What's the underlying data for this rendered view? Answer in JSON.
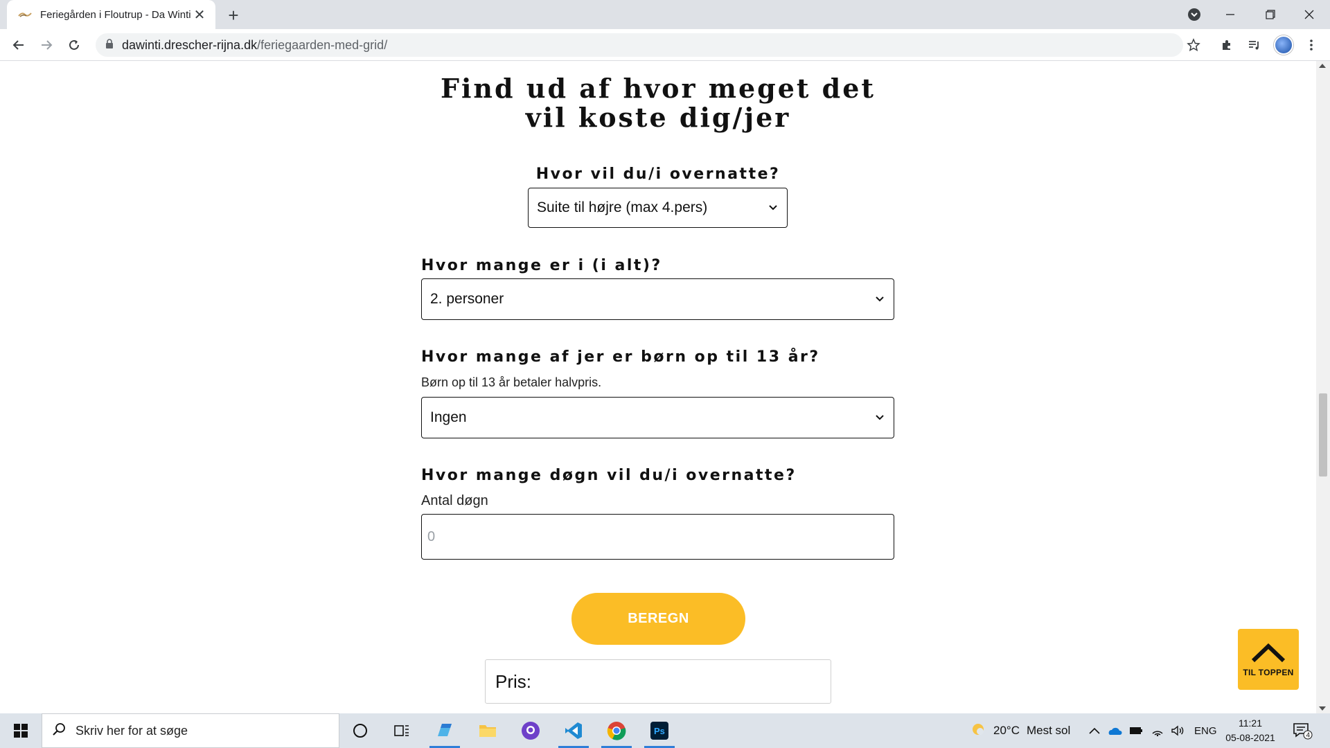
{
  "browser": {
    "tab_title": "Feriegården i Floutrup - Da Winti",
    "tab_close": "✕",
    "new_tab": "+",
    "url_host": "dawinti.drescher-rijna.dk",
    "url_path": "/feriegaarden-med-grid/"
  },
  "page": {
    "heading": "Find ud af hvor meget det vil koste dig/jer",
    "q1": {
      "label": "Hvor vil du/i overnatte?",
      "selected": "Suite til højre (max 4.pers)"
    },
    "q2": {
      "label": "Hvor mange er i (i alt)?",
      "selected": "2. personer"
    },
    "q3": {
      "label": "Hvor mange af jer er børn op til 13 år?",
      "help": "Børn op til 13 år betaler halvpris.",
      "selected": "Ingen"
    },
    "q4": {
      "label": "Hvor mange døgn vil du/i overnatte?",
      "help": "Antal døgn",
      "placeholder": "0"
    },
    "calculate_button": "BEREGN",
    "result_label": "Pris:",
    "to_top_label": "TIL TOPPEN"
  },
  "taskbar": {
    "search_placeholder": "Skriv her for at søge",
    "weather_temp": "20°C",
    "weather_text": "Mest sol",
    "language": "ENG",
    "time": "11:21",
    "date": "05-08-2021",
    "notification_count": "4"
  },
  "colors": {
    "accent": "#fbbd26",
    "taskbar": "#dde3ea",
    "tabbar": "#dee1e6"
  },
  "icons": {
    "favicon": "feriegaarden-favicon-icon",
    "to_top": "chevron-up-icon"
  }
}
